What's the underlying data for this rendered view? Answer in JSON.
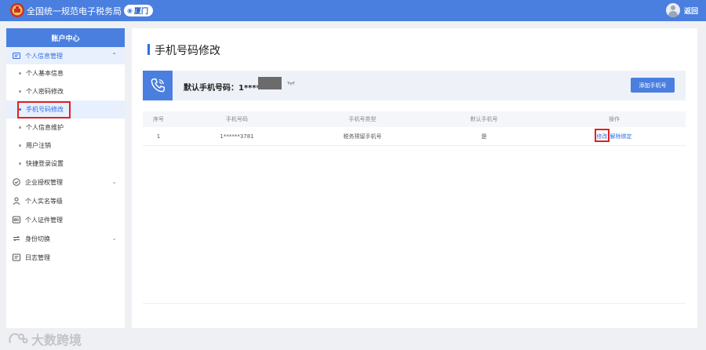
{
  "topbar": {
    "site_title": "全国统一规范电子税务局",
    "city": "厦门",
    "return_label": "返回"
  },
  "sidebar": {
    "header": "账户中心",
    "group_personal": "个人信息管理",
    "sub_items": [
      {
        "label": "个人基本信息"
      },
      {
        "label": "个人密码修改"
      },
      {
        "label": "手机号码修改"
      },
      {
        "label": "个人信息维护"
      },
      {
        "label": "用户注销"
      },
      {
        "label": "快捷登录设置"
      }
    ],
    "groups": [
      {
        "label": "企业授权管理"
      },
      {
        "label": "个人实名等级"
      },
      {
        "label": "个人证件管理"
      },
      {
        "label": "身份切换"
      },
      {
        "label": "日志管理"
      }
    ]
  },
  "main": {
    "title": "手机号码修改",
    "default_phone_label": "默认手机号码：1*****",
    "add_button": "添加手机号",
    "table": {
      "headers": [
        "序号",
        "手机号码",
        "手机号类型",
        "默认手机号",
        "操作"
      ],
      "rows": [
        {
          "index": "1",
          "phone": "1******3781",
          "type": "税务预留手机号",
          "default": "是",
          "op_modify": "修改",
          "op_unbind": "解除绑定"
        }
      ]
    }
  },
  "watermark": "大数跨境",
  "colors": {
    "accent": "#4a7fe0",
    "highlight": "#e02020"
  }
}
